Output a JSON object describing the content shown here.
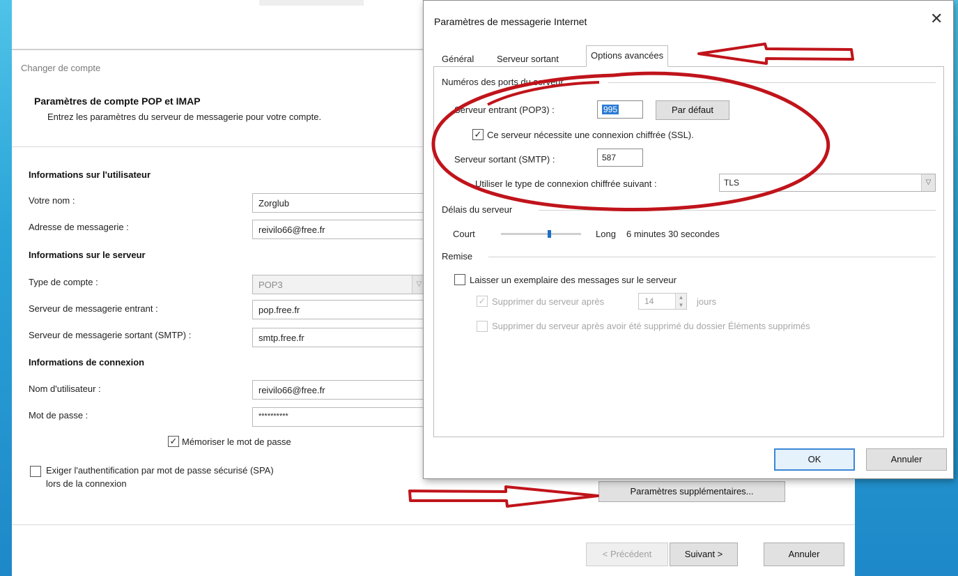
{
  "account_dialog": {
    "window_title": "Changer de compte",
    "header_title": "Paramètres de compte POP et IMAP",
    "header_subtitle": "Entrez les paramètres du serveur de messagerie pour votre compte.",
    "user_section": "Informations sur l'utilisateur",
    "name_label": "Votre nom :",
    "name_value": "Zorglub",
    "email_label": "Adresse de messagerie :",
    "email_value": "reivilo66@free.fr",
    "server_section": "Informations sur le serveur",
    "account_type_label": "Type de compte :",
    "account_type_value": "POP3",
    "incoming_label": "Serveur de messagerie entrant :",
    "incoming_value": "pop.free.fr",
    "outgoing_label": "Serveur de messagerie sortant (SMTP) :",
    "outgoing_value": "smtp.free.fr",
    "login_section": "Informations de connexion",
    "username_label": "Nom d'utilisateur :",
    "username_value": "reivilo66@free.fr",
    "password_label": "Mot de passe :",
    "password_value": "**********",
    "remember_password_label": "Mémoriser le mot de passe",
    "remember_password_checked": true,
    "spa_label_line1": "Exiger l'authentification par mot de passe sécurisé (SPA)",
    "spa_label_line2": "lors de la connexion",
    "spa_checked": false,
    "more_settings_button": "Paramètres supplémentaires...",
    "previous_button": "< Précédent",
    "next_button": "Suivant >",
    "cancel_button": "Annuler"
  },
  "internet_mail_dialog": {
    "title": "Paramètres de messagerie Internet",
    "close_glyph": "✕",
    "tabs": [
      "Général",
      "Serveur sortant",
      "Options avancées"
    ],
    "active_tab": "Options avancées",
    "ports_group": "Numéros des ports du serveur",
    "incoming_label": "Serveur entrant (POP3) :",
    "incoming_port": "995",
    "default_button": "Par défaut",
    "ssl_label": "Ce serveur nécessite une connexion chiffrée (SSL).",
    "ssl_checked": true,
    "outgoing_label": "Serveur sortant (SMTP) :",
    "outgoing_port": "587",
    "encryption_label": "Utiliser le type de connexion chiffrée suivant :",
    "encryption_value": "TLS",
    "timeout_group": "Délais du serveur",
    "timeout_short": "Court",
    "timeout_long": "Long",
    "timeout_value": "6 minutes 30 secondes",
    "timeout_level": 0.6,
    "delivery_group": "Remise",
    "leave_copy_label": "Laisser un exemplaire des messages sur le serveur",
    "leave_copy_checked": false,
    "remove_after_label": "Supprimer du serveur après",
    "remove_after_checked": true,
    "remove_after_days": "14",
    "days_label": "jours",
    "remove_deleted_label": "Supprimer du serveur après avoir été supprimé du dossier Éléments supprimés",
    "remove_deleted_checked": false,
    "ok_button": "OK",
    "cancel_button": "Annuler"
  },
  "annotation_color": "#c0141b"
}
